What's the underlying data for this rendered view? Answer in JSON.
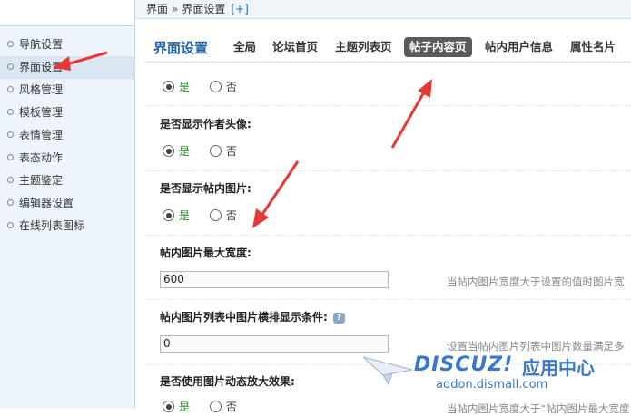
{
  "sidebar": {
    "items": [
      {
        "label": "导航设置"
      },
      {
        "label": "界面设置"
      },
      {
        "label": "风格管理"
      },
      {
        "label": "模板管理"
      },
      {
        "label": "表情管理"
      },
      {
        "label": "表态动作"
      },
      {
        "label": "主题鉴定"
      },
      {
        "label": "编辑器设置"
      },
      {
        "label": "在线列表图标"
      }
    ],
    "active_index": 1
  },
  "breadcrumb": {
    "parent": "界面",
    "separator": "»",
    "current": "界面设置",
    "add": "[+]"
  },
  "tabs": {
    "title": "界面设置",
    "items": [
      {
        "label": "全局"
      },
      {
        "label": "论坛首页"
      },
      {
        "label": "主题列表页"
      },
      {
        "label": "帖子内容页"
      },
      {
        "label": "帖内用户信息"
      },
      {
        "label": "属性名片"
      }
    ],
    "active_index": 3
  },
  "settings": {
    "row0": {
      "yes": "是",
      "no": "否",
      "selected": "yes"
    },
    "show_avatar": {
      "label": "是否显示作者头像:",
      "yes": "是",
      "no": "否",
      "selected": "yes"
    },
    "show_images": {
      "label": "是否显示帖内图片:",
      "yes": "是",
      "no": "否",
      "selected": "yes"
    },
    "max_width": {
      "label": "帖内图片最大宽度:",
      "value": "600",
      "hint": "当帖内图片宽度大于设置的值时图片宽"
    },
    "list_images": {
      "label": "帖内图片列表中图片横排显示条件:",
      "value": "0",
      "hint": "设置当帖内图片列表中图片数量满足多"
    },
    "zoom_effect": {
      "label": "是否使用图片动态放大效果:",
      "yes": "是",
      "no": "否",
      "selected": "yes",
      "hint": "当帖内图片宽度大于“帖内图片最大宽度"
    }
  },
  "watermark": {
    "brand": "DISCUZ!",
    "brand_suffix": "应用中心",
    "url": "addon.dismall.com"
  },
  "colors": {
    "accent": "#2366a8",
    "arrow": "#e53935",
    "active_tab": "#5b5b5b",
    "yes_text": "#2a8a2a"
  }
}
